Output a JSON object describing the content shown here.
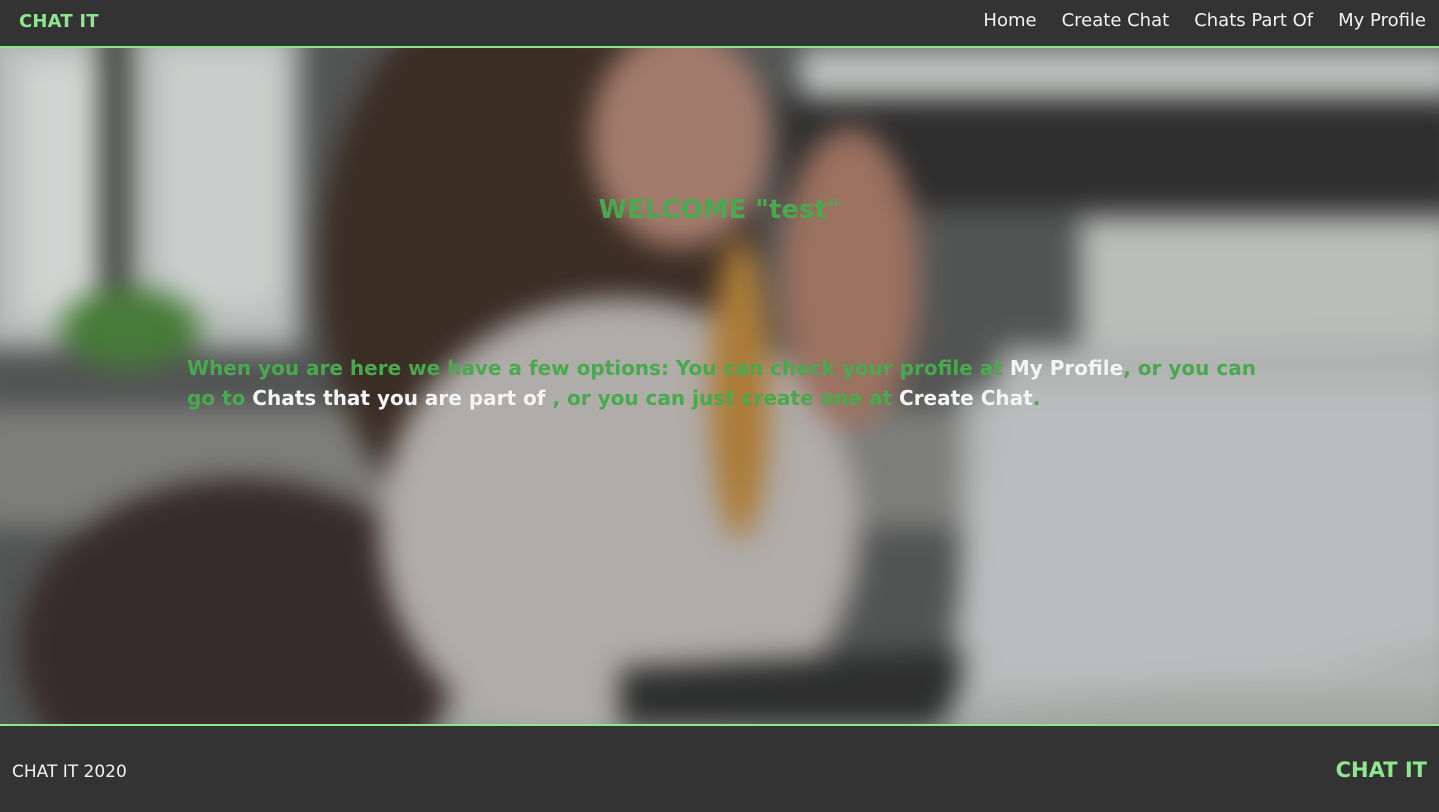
{
  "navbar": {
    "brand": "CHAT IT",
    "links": [
      {
        "label": "Home"
      },
      {
        "label": "Create Chat"
      },
      {
        "label": "Chats Part Of"
      },
      {
        "label": "My Profile"
      }
    ]
  },
  "main": {
    "welcome": "WELCOME \"test\"",
    "intro_part1": "When you are here we have a few options: You can check your profile at ",
    "profile_link": "My Profile",
    "intro_part2": ", or you can go to ",
    "chats_link": "Chats that you are part of ",
    "intro_part3": ", or you can just create one at ",
    "create_link": "Create Chat",
    "intro_end": "."
  },
  "footer": {
    "copyright": "CHAT IT 2020",
    "brand": "CHAT IT"
  },
  "colors": {
    "accent": "#8ee68e",
    "text_green": "#49a94e",
    "bar_bg": "#333333"
  }
}
